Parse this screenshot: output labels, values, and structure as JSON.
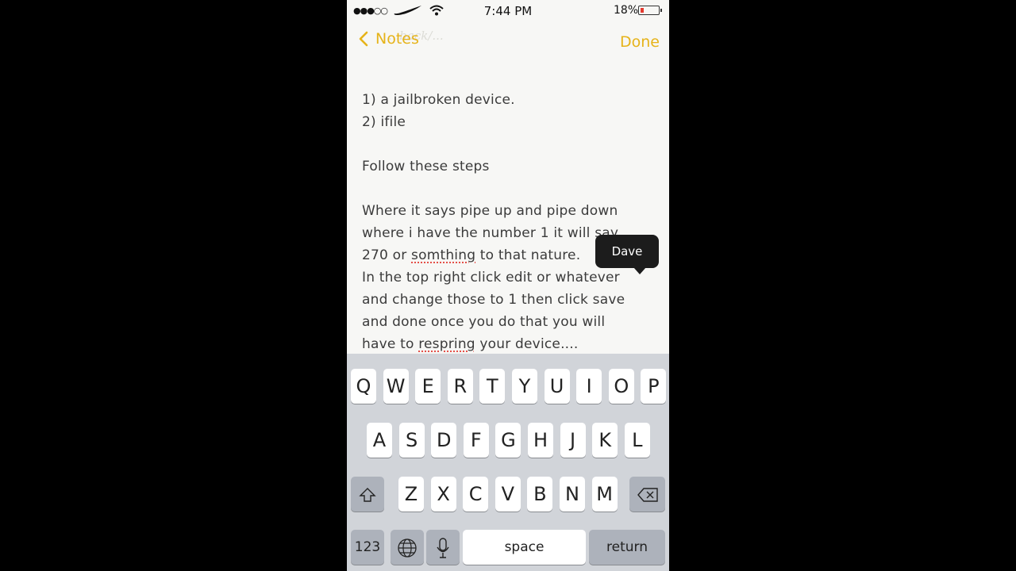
{
  "status_bar": {
    "signal": "●●●○○",
    "time": "7:44 PM",
    "battery_percent": "18%",
    "battery_level": 0.18,
    "battery_color": "#e53b30"
  },
  "nav": {
    "back_label": "Notes",
    "done_label": "Done",
    "accent_color": "#e6b319",
    "faded_text": "...back/..."
  },
  "note": {
    "lines": [
      "1) a jailbroken device.",
      "2) ifile",
      "",
      "Follow these steps",
      "",
      "Where it says pipe up and pipe down",
      "where i have the number 1 it will say",
      "270 or somthing to that nature.",
      "In the top right click edit or whatever",
      "and change those to 1 then click save",
      "and done once you do that you will",
      "have to respring your device...."
    ],
    "misspelled": [
      "somthing",
      "respring"
    ]
  },
  "tooltip": {
    "suggestion": "Dave"
  },
  "keyboard": {
    "row1": [
      "Q",
      "W",
      "E",
      "R",
      "T",
      "Y",
      "U",
      "I",
      "O",
      "P"
    ],
    "row2": [
      "A",
      "S",
      "D",
      "F",
      "G",
      "H",
      "J",
      "K",
      "L"
    ],
    "row3": [
      "Z",
      "X",
      "C",
      "V",
      "B",
      "N",
      "M"
    ],
    "numbers_label": "123",
    "space_label": "space",
    "return_label": "return",
    "icons": {
      "shift": "shift-icon",
      "delete": "delete-icon",
      "globe": "globe-icon",
      "mic": "microphone-icon"
    }
  }
}
